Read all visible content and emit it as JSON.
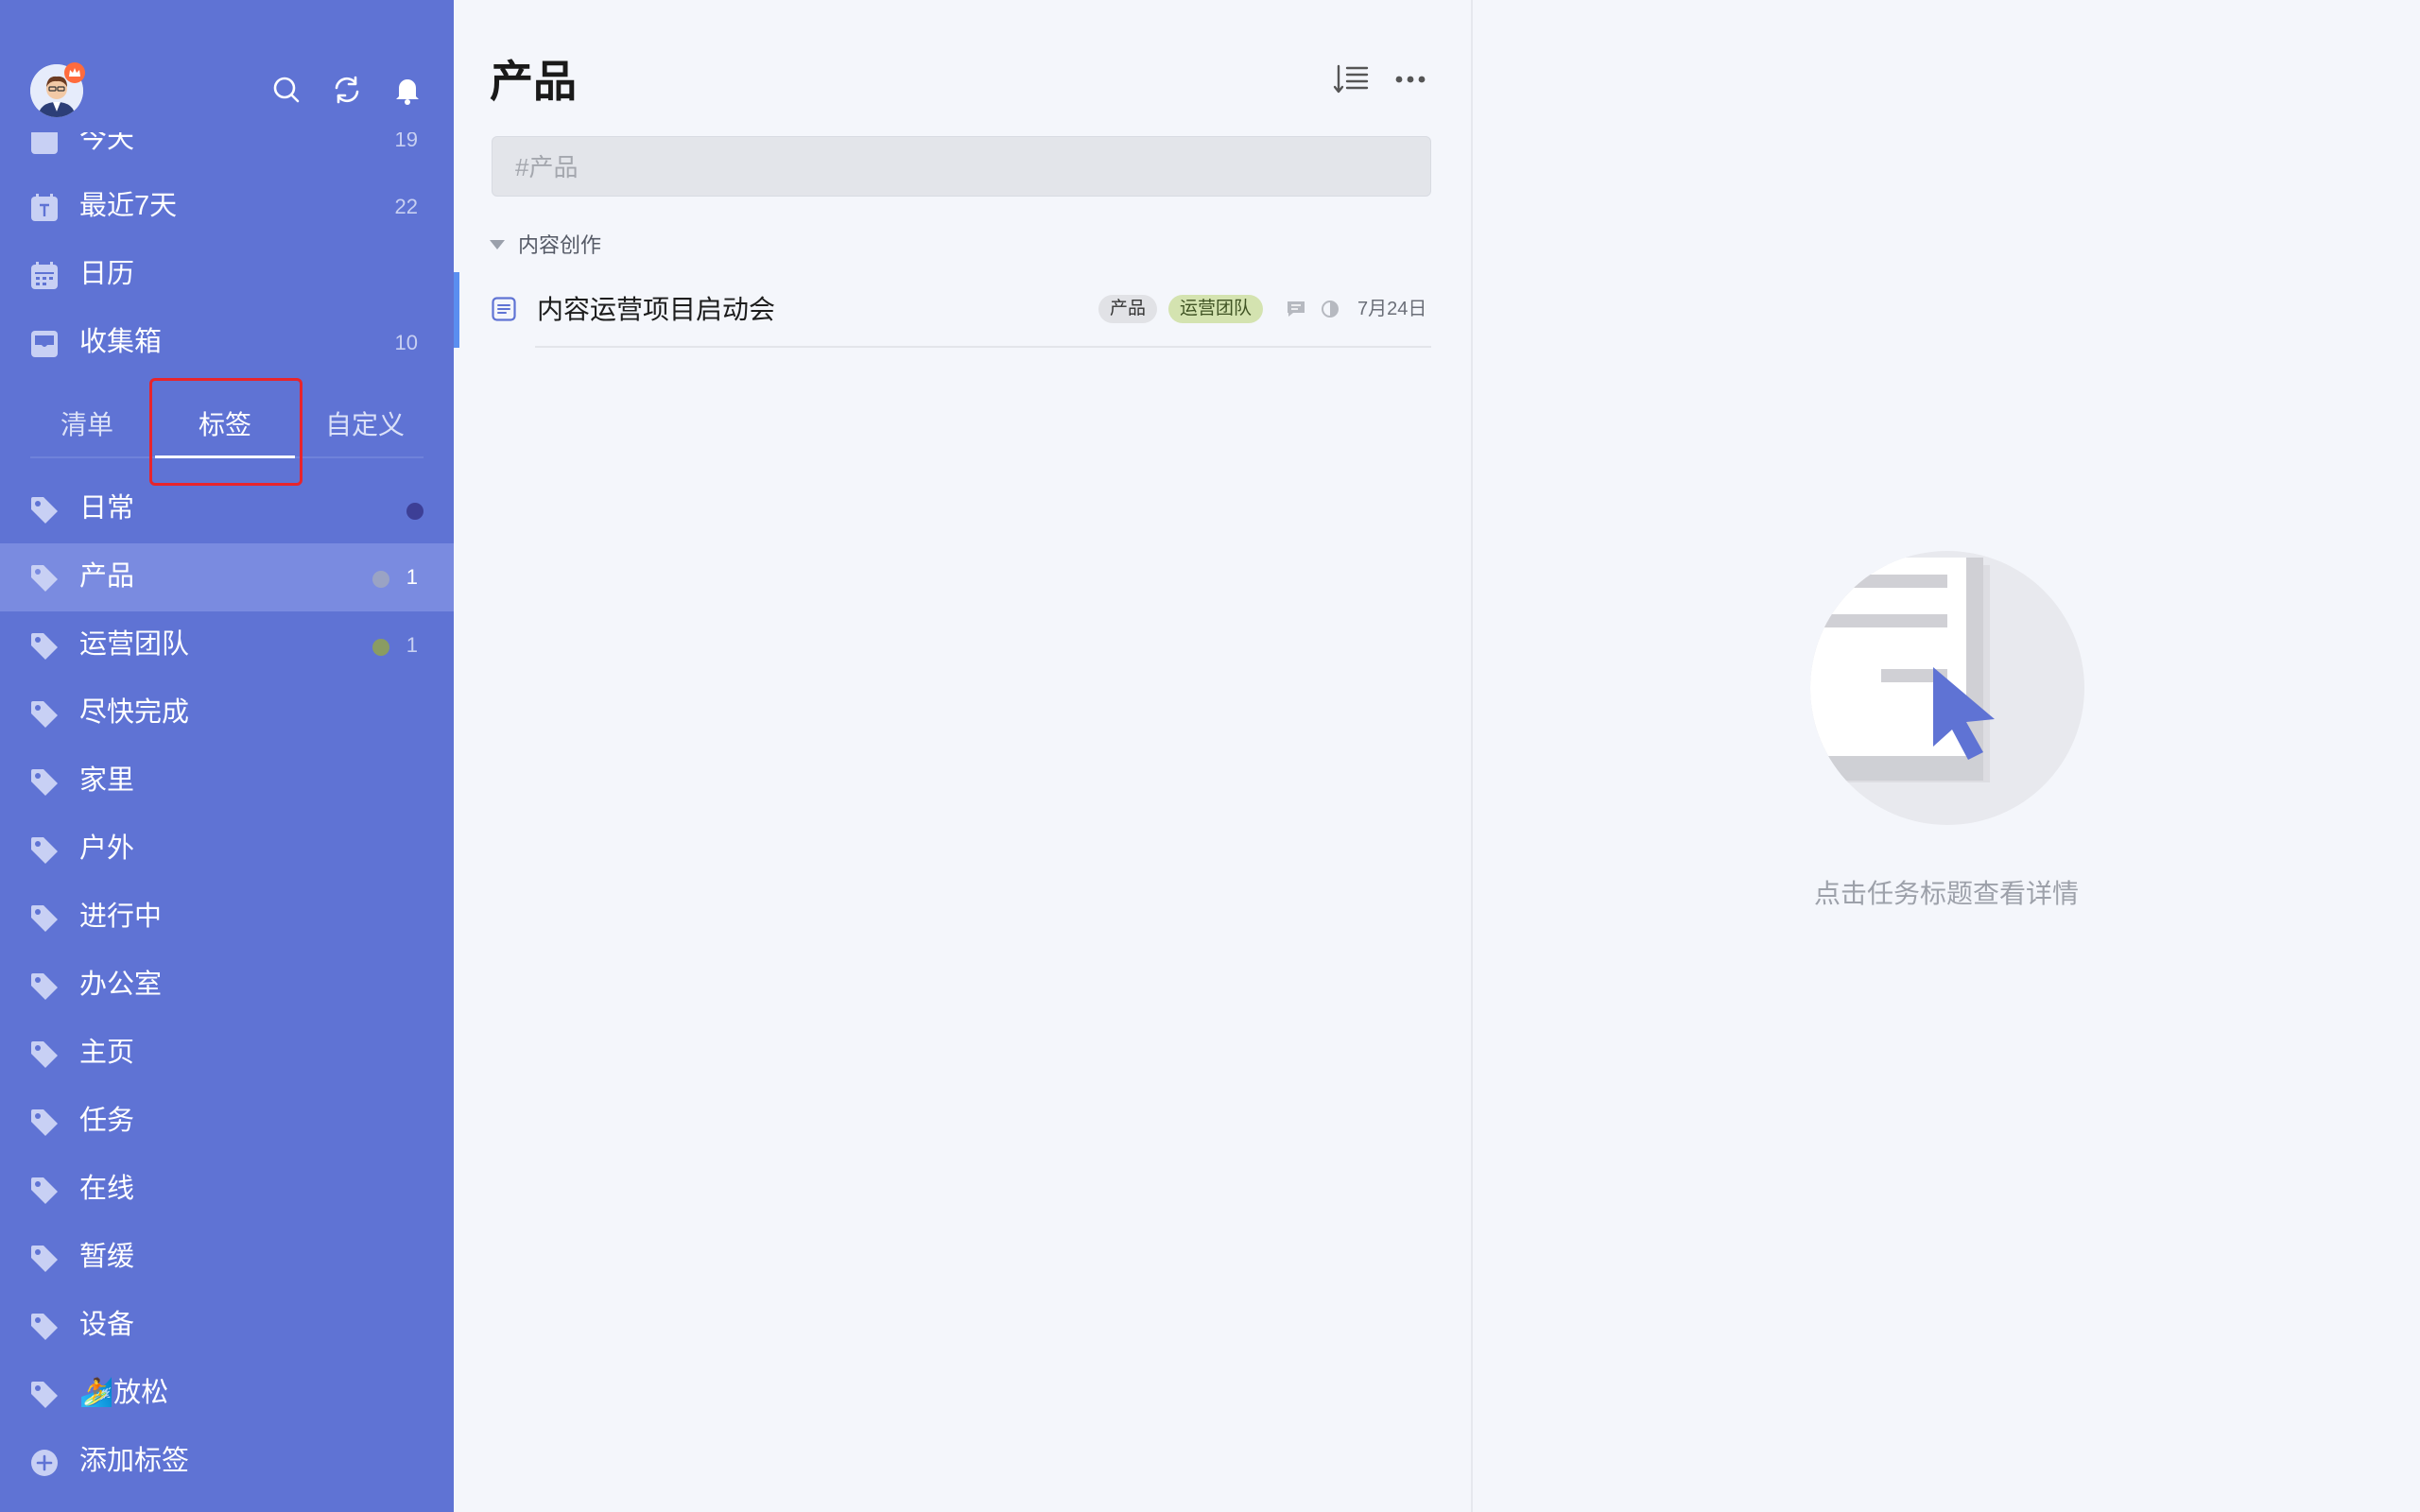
{
  "sidebar": {
    "smart_lists": [
      {
        "label": "今天",
        "count": "19",
        "icon": "calendar-today-icon"
      },
      {
        "label": "最近7天",
        "count": "22",
        "icon": "calendar-week-icon"
      },
      {
        "label": "日历",
        "count": "",
        "icon": "calendar-icon"
      },
      {
        "label": "收集箱",
        "count": "10",
        "icon": "inbox-icon"
      }
    ],
    "tabs": {
      "lists": "清单",
      "tags": "标签",
      "custom": "自定义"
    },
    "tags": [
      {
        "label": "日常",
        "count": "",
        "dot": "#3d3f96"
      },
      {
        "label": "产品",
        "count": "1",
        "dot": "#9aa3c4"
      },
      {
        "label": "运营团队",
        "count": "1",
        "dot": "#8a9c62"
      },
      {
        "label": "尽快完成",
        "count": "",
        "dot": ""
      },
      {
        "label": "家里",
        "count": "",
        "dot": ""
      },
      {
        "label": "户外",
        "count": "",
        "dot": ""
      },
      {
        "label": "进行中",
        "count": "",
        "dot": ""
      },
      {
        "label": "办公室",
        "count": "",
        "dot": ""
      },
      {
        "label": "主页",
        "count": "",
        "dot": ""
      },
      {
        "label": "任务",
        "count": "",
        "dot": ""
      },
      {
        "label": "在线",
        "count": "",
        "dot": ""
      },
      {
        "label": "暂缓",
        "count": "",
        "dot": ""
      },
      {
        "label": "设备",
        "count": "",
        "dot": ""
      },
      {
        "label": "🏄放松",
        "count": "",
        "dot": ""
      }
    ],
    "add_tag": "添加标签"
  },
  "main": {
    "title": "产品",
    "quick_add_placeholder": "#产品",
    "section": "内容创作",
    "task": {
      "title": "内容运营项目启动会",
      "tags": [
        "产品",
        "运营团队"
      ],
      "date": "7月24日"
    }
  },
  "detail": {
    "empty_text": "点击任务标题查看详情"
  },
  "colors": {
    "sidebar_bg": "#5f73d4",
    "accent": "#5a8ef0",
    "highlight": "#e8242b"
  }
}
